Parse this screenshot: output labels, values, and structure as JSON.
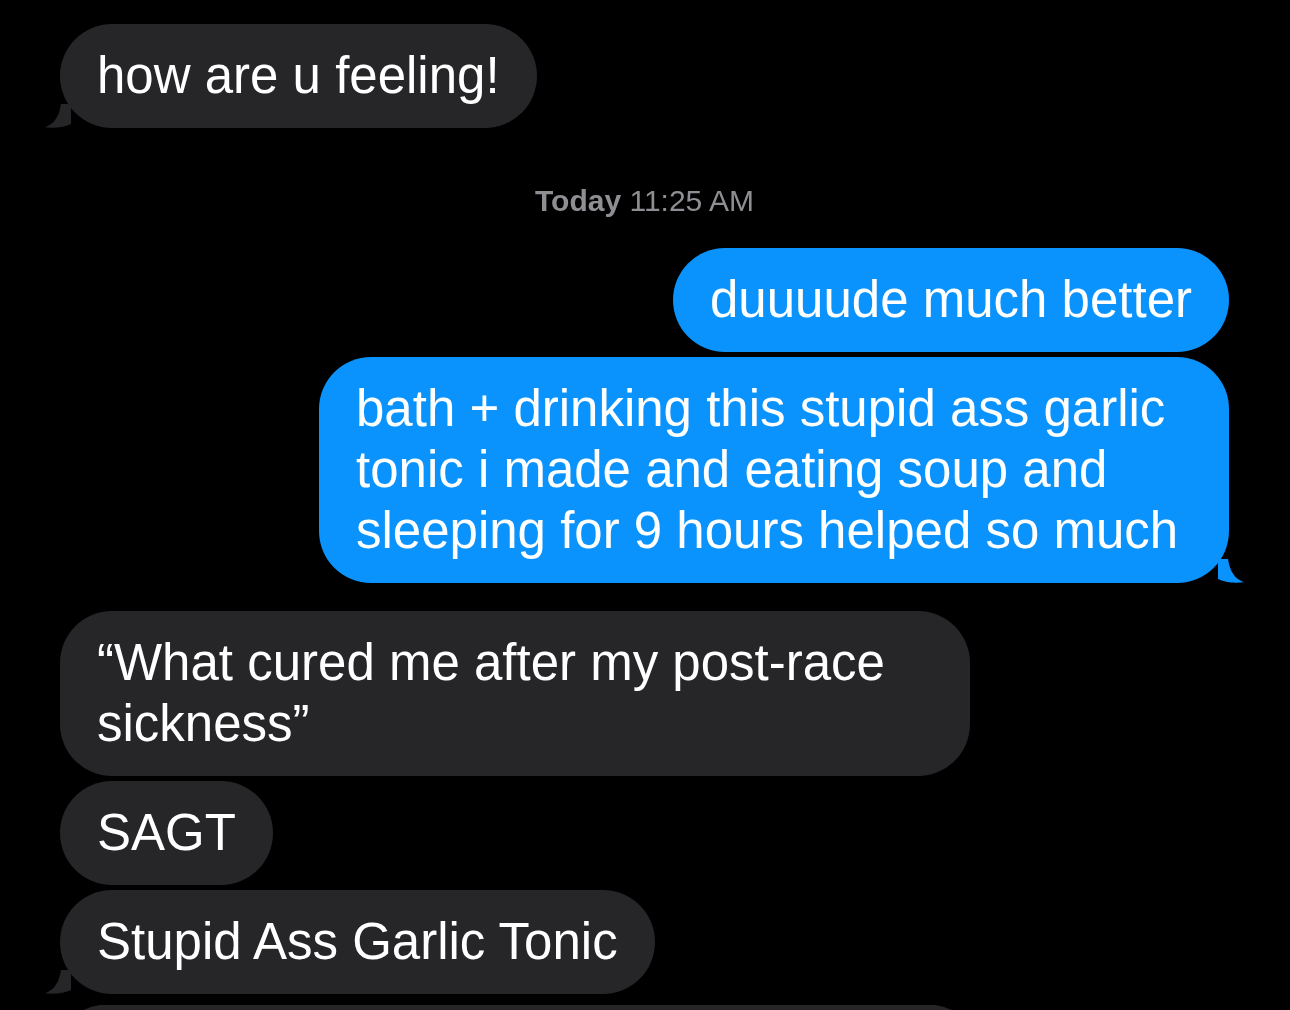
{
  "messages": [
    {
      "kind": "received",
      "text": "how are u feeling!",
      "tail": true
    },
    {
      "kind": "timestamp",
      "text": "**Today** 11:25 AM"
    },
    {
      "kind": "sent",
      "text": "duuuude much better",
      "tail": false
    },
    {
      "kind": "sent",
      "text": "bath + drinking this stupid ass garlic tonic i made and eating soup and sleeping for 9 hours helped so much",
      "tail": true
    },
    {
      "kind": "received",
      "text": "“What cured me after my post-race sickness”",
      "tail": false
    },
    {
      "kind": "received",
      "text": "SAGT",
      "tail": false
    },
    {
      "kind": "received",
      "text": "Stupid Ass Garlic Tonic",
      "tail": true
    },
    {
      "kind": "received",
      "cut_off": true
    }
  ]
}
